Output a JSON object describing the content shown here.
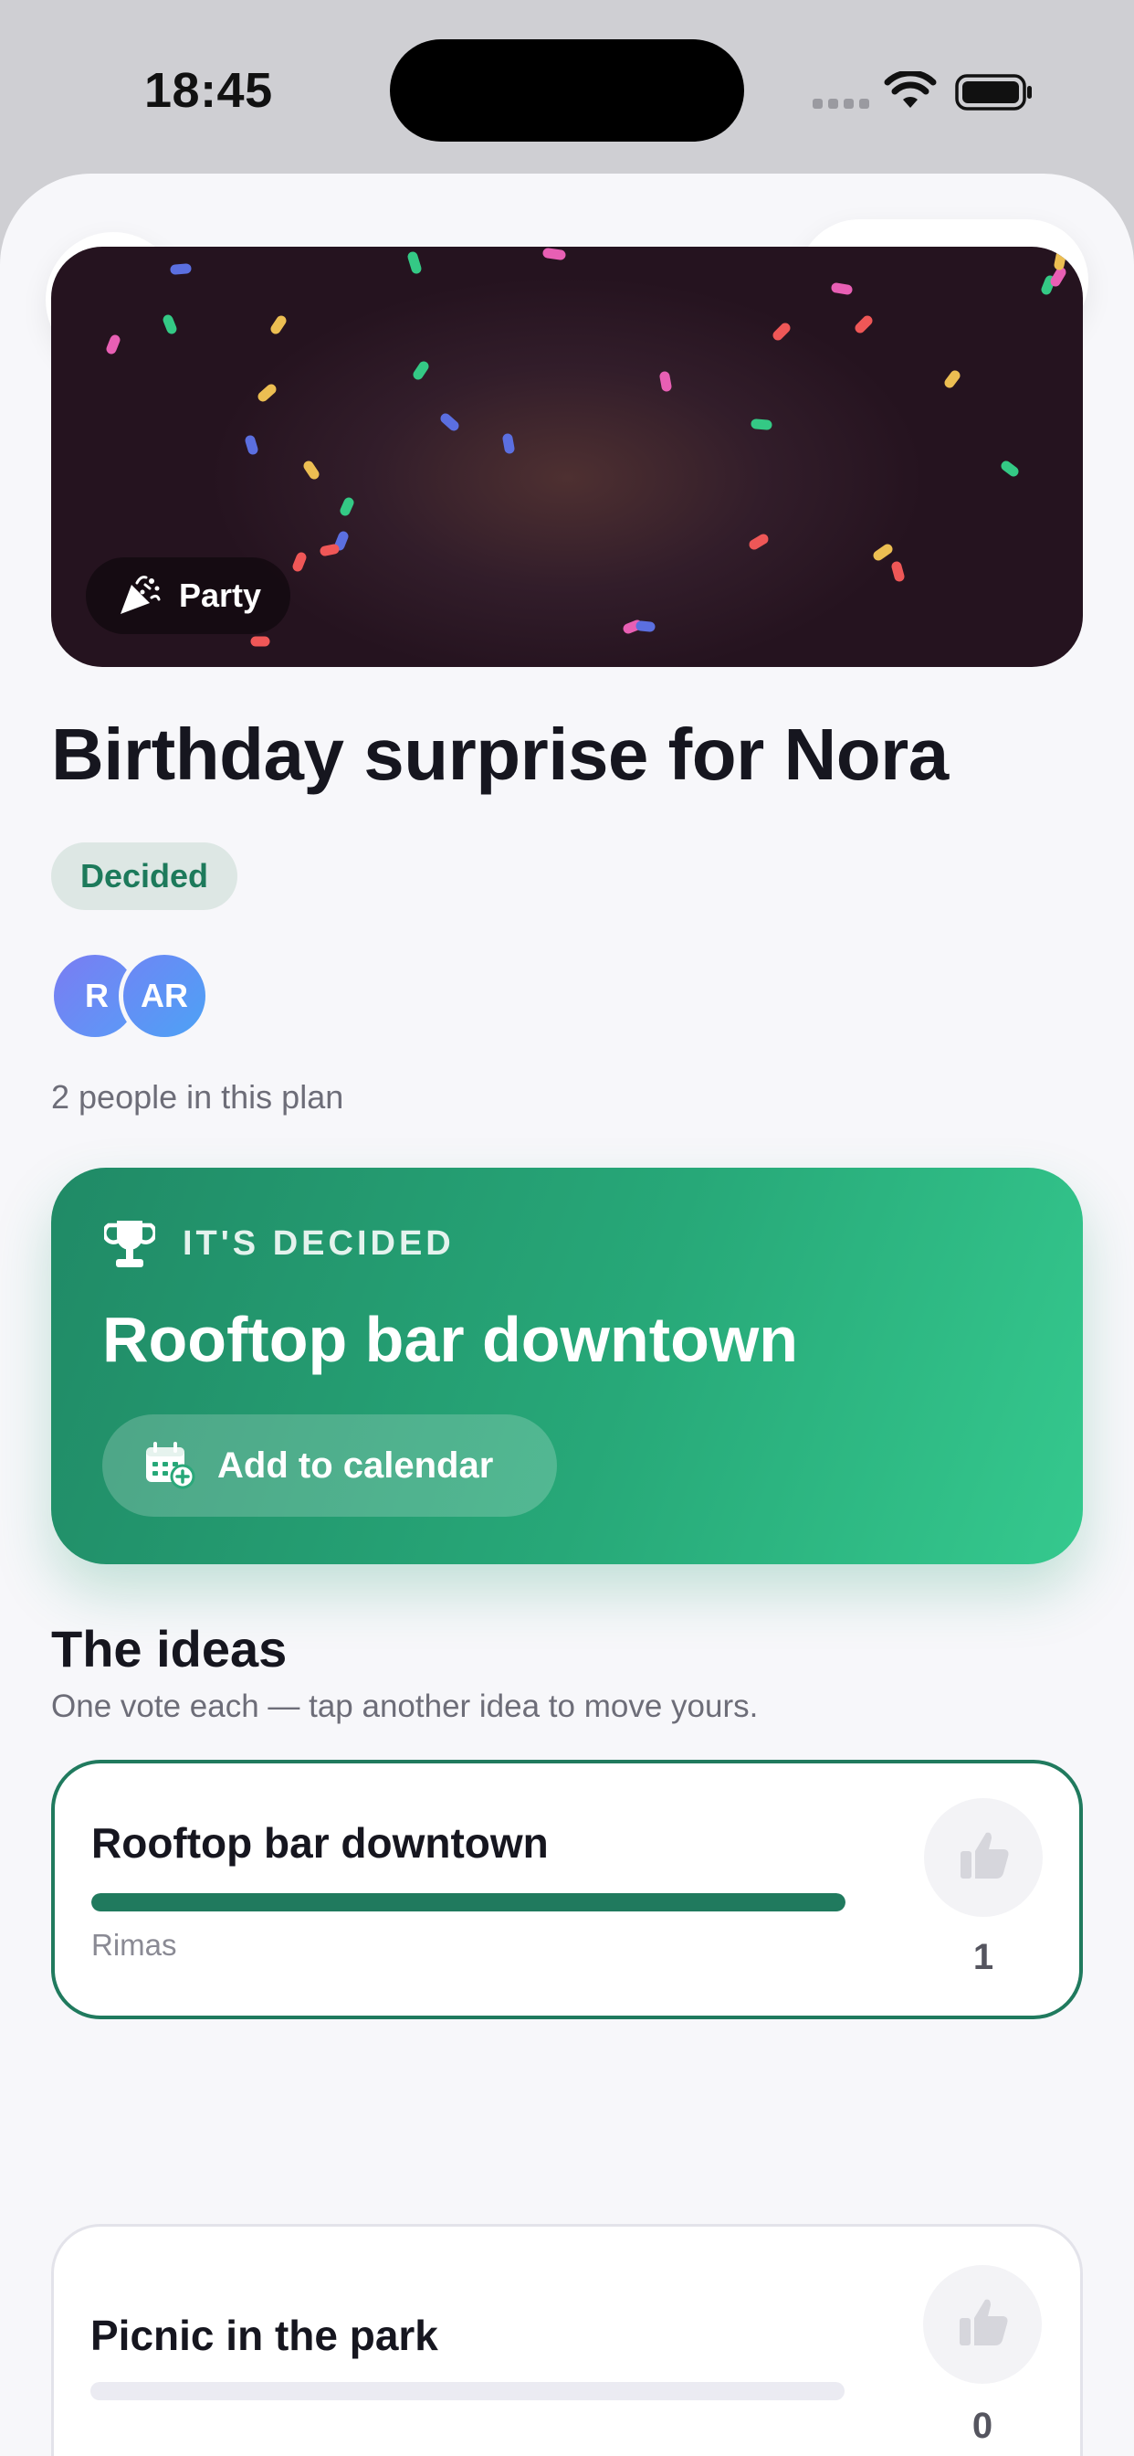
{
  "status_bar": {
    "time": "18:45"
  },
  "hero": {
    "category": "Party"
  },
  "plan": {
    "title": "Birthday surprise for Nora",
    "status": "Decided",
    "people_text": "2 people in this plan",
    "members": [
      {
        "initials": "R"
      },
      {
        "initials": "AR"
      }
    ]
  },
  "decision": {
    "caption": "IT'S DECIDED",
    "title": "Rooftop bar downtown",
    "calendar_label": "Add to calendar"
  },
  "ideas": {
    "heading": "The ideas",
    "subtitle": "One vote each — tap another idea to move yours.",
    "items": [
      {
        "name": "Rooftop bar downtown",
        "author": "Rimas",
        "votes": "1",
        "vote_share": 1.0
      },
      {
        "name": "Picnic in the park",
        "author": "",
        "votes": "0",
        "vote_share": 0.0
      }
    ]
  },
  "colors": {
    "accent": "#F2605A",
    "success": "#207A5E",
    "decided_gradient": [
      "#208A66",
      "#35C98E"
    ],
    "hero_background": "#25131F"
  },
  "icons": [
    "chevron-down-icon",
    "share-icon",
    "more-icon",
    "party-popper-icon",
    "trophy-icon",
    "calendar-add-icon",
    "thumbs-up-icon",
    "wifi-icon",
    "battery-icon"
  ]
}
